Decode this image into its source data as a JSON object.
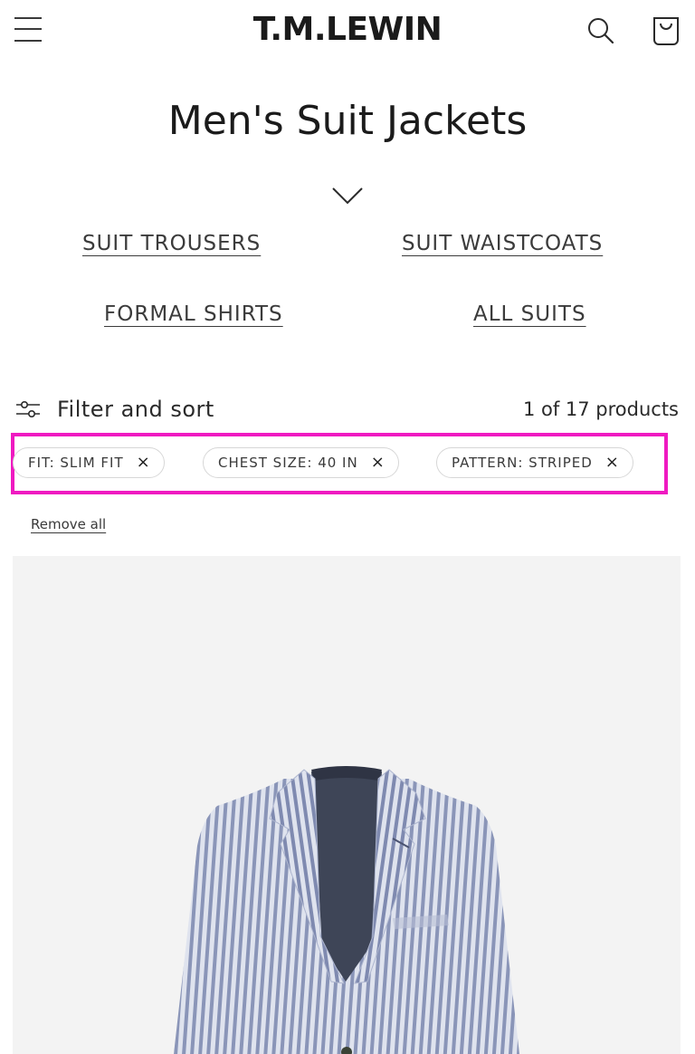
{
  "header": {
    "logo": "T.M.LEWIN",
    "menu_icon": "hamburger-menu-icon",
    "search_icon": "search-icon",
    "cart_icon": "shopping-bag-icon"
  },
  "collection": {
    "title": "Men's Suit Jackets",
    "expand_icon": "chevron-down-icon",
    "links": [
      {
        "label": "SUIT TROUSERS"
      },
      {
        "label": "SUIT WAISTCOATS"
      },
      {
        "label": "FORMAL SHIRTS"
      },
      {
        "label": "ALL SUITS"
      }
    ]
  },
  "filters": {
    "toggle_label": "Filter and sort",
    "toggle_icon": "sliders-icon",
    "product_count": "1 of 17 products",
    "active": [
      {
        "label": "FIT: SLIM FIT",
        "remove": "×"
      },
      {
        "label": "CHEST SIZE: 40 IN",
        "remove": "×"
      },
      {
        "label": "PATTERN: STRIPED",
        "remove": "×"
      }
    ],
    "remove_all": "Remove all",
    "highlight_color": "#ef1ac1"
  },
  "colors": {
    "text": "#1b1b1b",
    "image_background": "#f3f3f3",
    "jacket_stripe": "#8a95b8",
    "jacket_lining": "#3e4557"
  }
}
